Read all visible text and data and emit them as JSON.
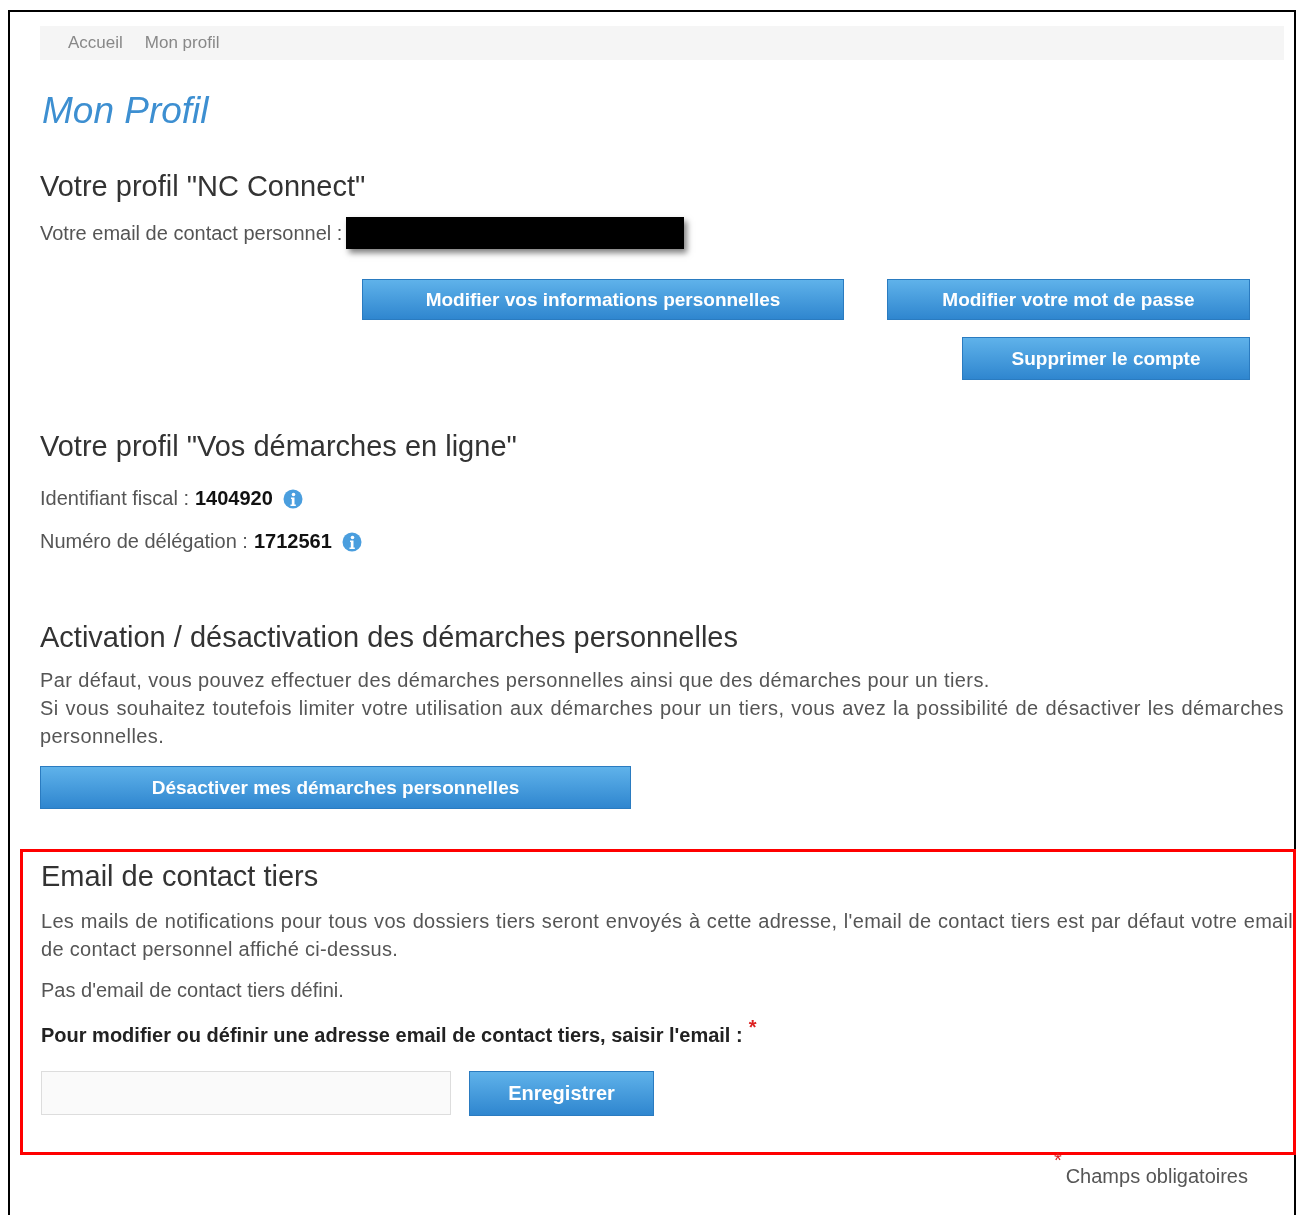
{
  "breadcrumb": [
    "Accueil",
    "Mon profil"
  ],
  "title": "Mon Profil",
  "nc_connect": {
    "heading": "Votre profil \"NC Connect\"",
    "email_label": "Votre email de contact personnel :",
    "email_redacted": true,
    "buttons": [
      "Modifier vos informations personnelles",
      "Modifier votre mot de passe",
      "Supprimer le compte"
    ]
  },
  "demarches": {
    "heading": "Votre profil \"Vos démarches en ligne\"",
    "fields": [
      {
        "label": "Identifiant fiscal :",
        "value": "1404920"
      },
      {
        "label": "Numéro de délégation :",
        "value": "1712561"
      }
    ]
  },
  "activation": {
    "heading": "Activation / désactivation des démarches personnelles",
    "paragraph": [
      "Par défaut, vous pouvez effectuer des démarches personnelles ainsi que des démarches pour un tiers.",
      "Si vous souhaitez toutefois limiter votre utilisation aux démarches pour un tiers, vous avez la possibilité de désactiver les démarches personnelles."
    ],
    "button": "Désactiver mes démarches personnelles"
  },
  "contact_tiers": {
    "highlighted": true,
    "heading": "Email de contact tiers",
    "description": "Les mails de notifications pour tous vos dossiers tiers seront envoyés à cette adresse, l'email de contact tiers est par défaut votre email de contact personnel affiché ci-dessus.",
    "status": "Pas d'email de contact tiers défini.",
    "field_label": "Pour modifier ou définir une adresse email de contact tiers, saisir l'email :",
    "required_mark": "*",
    "button": "Enregistrer"
  },
  "footer": {
    "required_mark": "*",
    "note": "Champs obligatoires"
  }
}
